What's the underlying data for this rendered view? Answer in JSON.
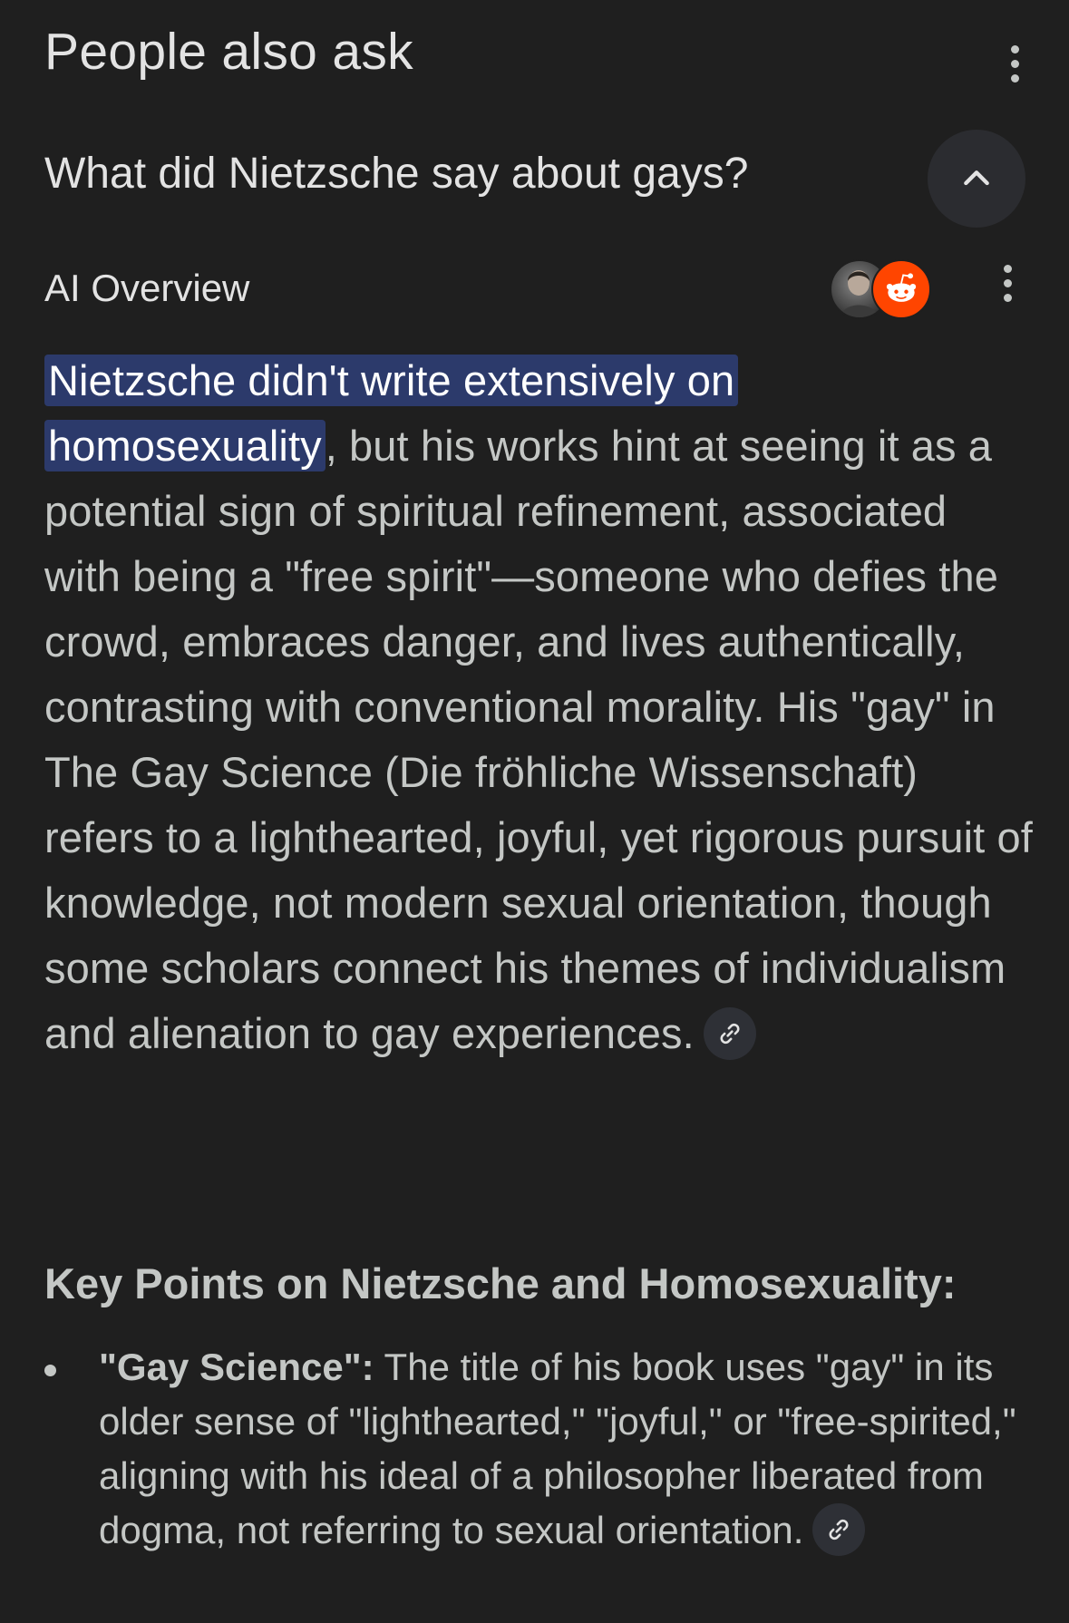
{
  "header": {
    "title": "People also ask"
  },
  "question": {
    "text": "What did Nietzsche say about gays?"
  },
  "ai_overview": {
    "label": "AI Overview",
    "highlight_line1": "Nietzsche didn't write extensively on",
    "highlight_line2": "homosexuality",
    "body": ", but his works hint at seeing it as a potential sign of spiritual refinement, associated with being a \"free spirit\"—someone who defies the crowd, embraces danger, and lives authentically, contrasting with conventional morality. His \"gay\" in The Gay Science (Die fröhliche Wissenschaft) refers to a lighthearted, joyful, yet rigorous pursuit of knowledge, not modern sexual orientation, though some scholars connect his themes of individualism and alienation to gay experiences."
  },
  "key_points": {
    "heading": "Key Points on Nietzsche and Homosexuality:",
    "items": [
      {
        "term": "\"Gay Science\":",
        "text": " The title of his book uses \"gay\" in its older sense of \"lighthearted,\" \"joyful,\" or \"free-spirited,\" aligning with his ideal of a philosopher liberated from dogma, not referring to sexual orientation."
      }
    ]
  },
  "icons": {
    "header_menu": "more-vert-icon",
    "collapse": "chevron-up-icon",
    "source_avatar": "person-photo-avatar",
    "source_reddit": "reddit-icon",
    "ai_menu": "more-vert-icon",
    "citation": "link-icon"
  },
  "colors": {
    "background": "#1f1f1f",
    "text_primary": "#e3e3e3",
    "text_secondary": "#c4c7c5",
    "highlight_bg": "#2c3a6b",
    "chip_bg": "#2e3036",
    "collapse_bg": "#2b2c30",
    "reddit": "#ff4500"
  }
}
